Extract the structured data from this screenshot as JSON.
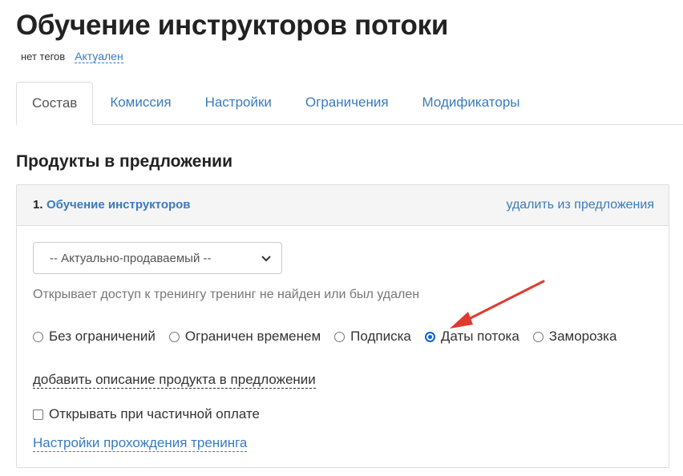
{
  "page": {
    "title": "Обучение инструкторов потоки",
    "tags_text": "нет тегов",
    "status_link": "Актуален"
  },
  "tabs": [
    {
      "label": "Состав",
      "active": true
    },
    {
      "label": "Комиссия",
      "active": false
    },
    {
      "label": "Настройки",
      "active": false
    },
    {
      "label": "Ограничения",
      "active": false
    },
    {
      "label": "Модификаторы",
      "active": false
    }
  ],
  "section": {
    "title": "Продукты в предложении"
  },
  "product": {
    "number": "1.",
    "name": "Обучение инструкторов",
    "remove_label": "удалить из предложения",
    "select_value": "-- Актуально-продаваемый --",
    "access_hint": "Открывает доступ к тренингу тренинг не найден или был удален",
    "radio_options": [
      {
        "label": "Без ограничений",
        "checked": false
      },
      {
        "label": "Ограничен временем",
        "checked": false
      },
      {
        "label": "Подписка",
        "checked": false
      },
      {
        "label": "Даты потока",
        "checked": true
      },
      {
        "label": "Заморозка",
        "checked": false
      }
    ],
    "add_description_label": "добавить описание продукта в предложении",
    "partial_payment_label": "Открывать при частичной оплате",
    "partial_payment_checked": false,
    "training_settings_link": "Настройки прохождения тренинга"
  },
  "colors": {
    "link": "#3a7bbf",
    "radio_checked": "#0a63d6",
    "annotation_arrow": "#e03a2f"
  },
  "icons": {
    "select_chevron": "chevron-down-icon",
    "annotation": "red-arrow-icon"
  }
}
